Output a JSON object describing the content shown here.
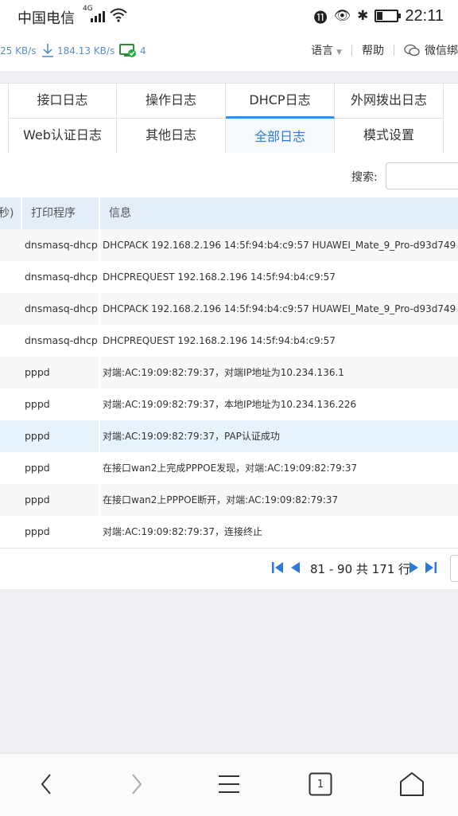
{
  "status_bar": {
    "carrier": "中国电信",
    "network": "4G",
    "time": "22:11",
    "battery_level": 0.3
  },
  "top_bar": {
    "upload_speed": "25 KB/s",
    "download_speed": "184.13 KB/s",
    "device_count": "4",
    "language": "语言",
    "help": "帮助",
    "wechat": "微信绑"
  },
  "tabs": {
    "row1": [
      "接口日志",
      "操作日志",
      "DHCP日志",
      "外网拨出日志"
    ],
    "row2": [
      "Web认证日志",
      "其他日志",
      "全部日志",
      "模式设置"
    ],
    "active": "全部日志"
  },
  "search": {
    "label": "搜索:",
    "value": ""
  },
  "table": {
    "headers": [
      "秒)",
      "打印程序",
      "信息"
    ],
    "rows": [
      {
        "program": "dnsmasq-dhcp",
        "message": "DHCPACK 192.168.2.196 14:5f:94:b4:c9:57 HUAWEI_Mate_9_Pro-d93d749"
      },
      {
        "program": "dnsmasq-dhcp",
        "message": "DHCPREQUEST 192.168.2.196 14:5f:94:b4:c9:57"
      },
      {
        "program": "dnsmasq-dhcp",
        "message": "DHCPACK 192.168.2.196 14:5f:94:b4:c9:57 HUAWEI_Mate_9_Pro-d93d749"
      },
      {
        "program": "dnsmasq-dhcp",
        "message": "DHCPREQUEST 192.168.2.196 14:5f:94:b4:c9:57"
      },
      {
        "program": "pppd",
        "message": "对端:AC:19:09:82:79:37，对端IP地址为10.234.136.1"
      },
      {
        "program": "pppd",
        "message": "对端:AC:19:09:82:79:37，本地IP地址为10.234.136.226"
      },
      {
        "program": "pppd",
        "message": "对端:AC:19:09:82:79:37，PAP认证成功"
      },
      {
        "program": "pppd",
        "message": "在接口wan2上完成PPPOE发现，对端:AC:19:09:82:79:37"
      },
      {
        "program": "pppd",
        "message": "在接口wan2上PPPOE断开，对端:AC:19:09:82:79:37"
      },
      {
        "program": "pppd",
        "message": "对端:AC:19:09:82:79:37，连接终止"
      }
    ]
  },
  "pager": {
    "text": "81 - 90 共 171 行"
  },
  "nav": {
    "tab_count": "1"
  },
  "colors": {
    "accent": "#2f7ad6",
    "header_bg": "#e3eef8",
    "highlight_row": "#e6f3fb"
  }
}
